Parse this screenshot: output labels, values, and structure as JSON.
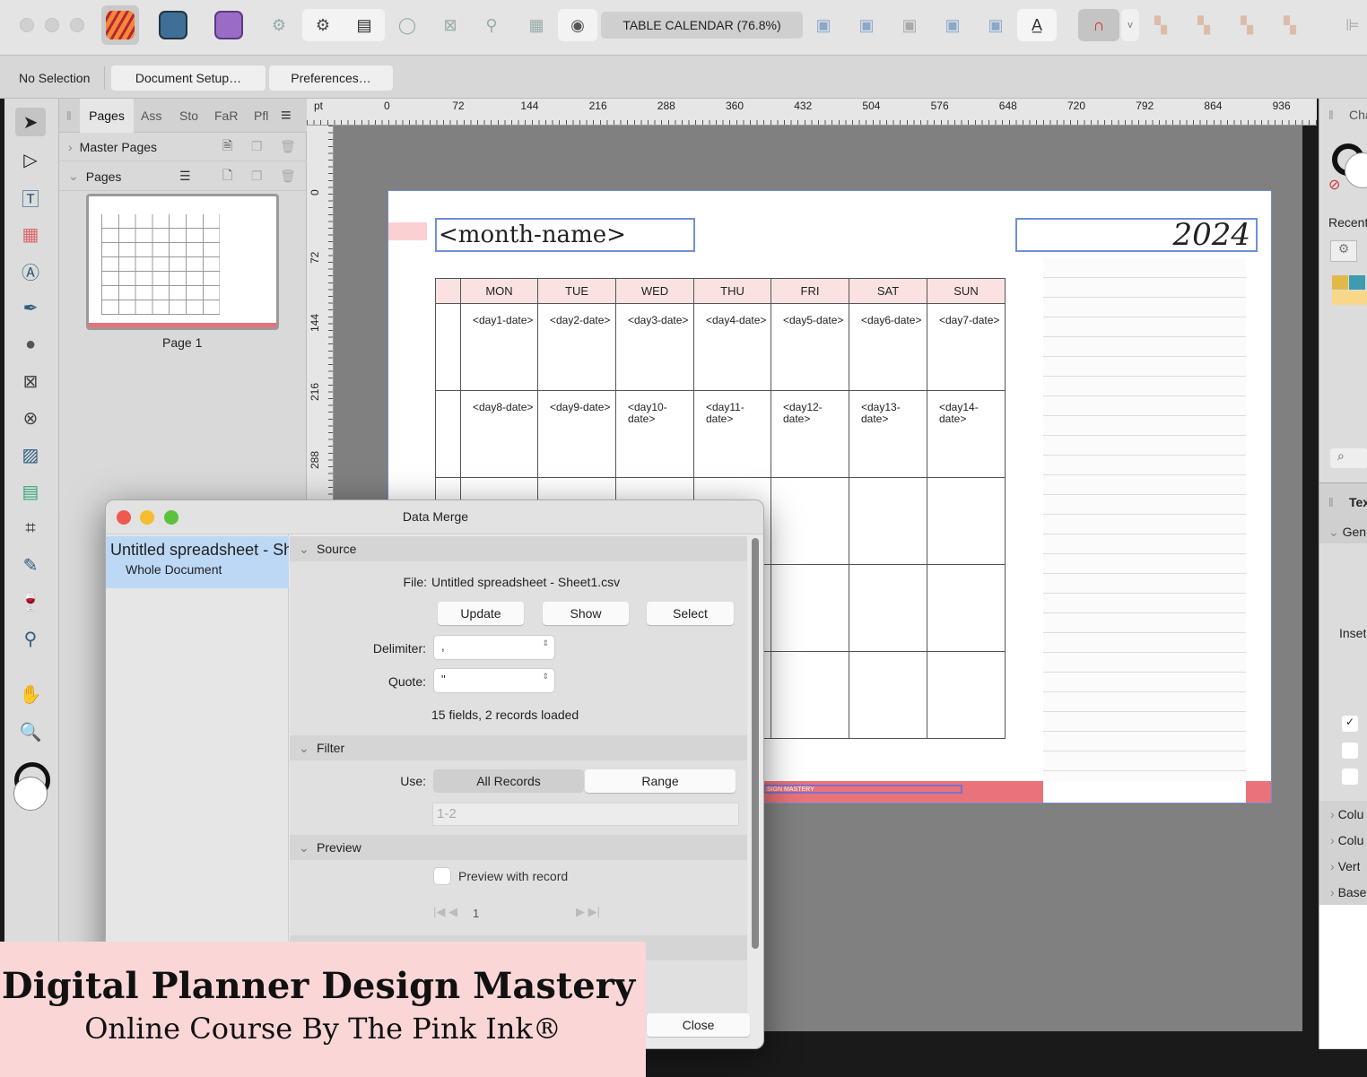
{
  "toolbar": {
    "document_label": "TABLE CALENDAR (76.8%)",
    "icons": [
      "publisher-app-icon",
      "designer-app-icon",
      "photo-app-icon",
      "settings-icon",
      "preflight-icon",
      "document-icon",
      "align-icon",
      "picture-frame-icon",
      "pin-icon",
      "wrap-icon",
      "eye-icon",
      "insert-before-icon",
      "delete-icon",
      "rotate-icon",
      "cycle-icon",
      "flip-icon",
      "text-flow-icon",
      "snapping-magnet-icon",
      "arrange-icons"
    ]
  },
  "context": {
    "selection": "No Selection",
    "document_setup": "Document Setup…",
    "preferences": "Preferences…"
  },
  "pages_panel": {
    "tabs": [
      "Pages",
      "Ass",
      "Sto",
      "FaR",
      "Pfl"
    ],
    "master_pages": "Master Pages",
    "pages": "Pages",
    "page_label": "Page 1"
  },
  "ruler": {
    "unit": "pt",
    "top": [
      "0",
      "72",
      "144",
      "216",
      "288",
      "360",
      "432",
      "504",
      "576",
      "648",
      "720",
      "792",
      "864",
      "936"
    ],
    "left": [
      "0",
      "72",
      "144",
      "216",
      "288"
    ]
  },
  "document": {
    "month_name": "<month-name>",
    "year": "2024",
    "days": [
      "MON",
      "TUE",
      "WED",
      "THU",
      "FRI",
      "SAT",
      "SUN"
    ],
    "row1": [
      "<day1-date>",
      "<day2-date>",
      "<day3-date>",
      "<day4-date>",
      "<day5-date>",
      "<day6-date>",
      "<day7-date>"
    ],
    "row2": [
      "<day8-date>",
      "<day9-date>",
      "<day10-date>",
      "<day11-date>",
      "<day12-date>",
      "<day13-date>",
      "<day14-date>"
    ],
    "footer": "SIGN MASTERY",
    "colors": {
      "accent_pink": "#e8737a",
      "header_pink": "#fbe2e2"
    }
  },
  "right_panel": {
    "char_tab": "Cha",
    "recent": "Recent",
    "text_tab": "Tex",
    "general": "Gen",
    "inset": "Inset",
    "sections": [
      "Colu",
      "Colu",
      "Vert",
      "Base"
    ]
  },
  "dialog": {
    "title": "Data Merge",
    "list_item": "Untitled spreadsheet - Sheet1.csv",
    "list_sub": "Whole Document",
    "source": {
      "header": "Source",
      "file_label": "File:",
      "file": "Untitled spreadsheet - Sheet1.csv",
      "update": "Update",
      "show": "Show",
      "select": "Select",
      "delimiter_label": "Delimiter:",
      "delimiter": ",",
      "quote_label": "Quote:",
      "quote": "\"",
      "status": "15 fields, 2 records loaded"
    },
    "filter": {
      "header": "Filter",
      "use_label": "Use:",
      "all_records": "All Records",
      "range": "Range",
      "range_value": "1-2"
    },
    "preview": {
      "header": "Preview",
      "checkbox": "Preview with record",
      "record": "1"
    },
    "close": "Close"
  },
  "banner": {
    "title": "Digital Planner Design Mastery",
    "subtitle": "Online Course By The Pink Ink®"
  }
}
